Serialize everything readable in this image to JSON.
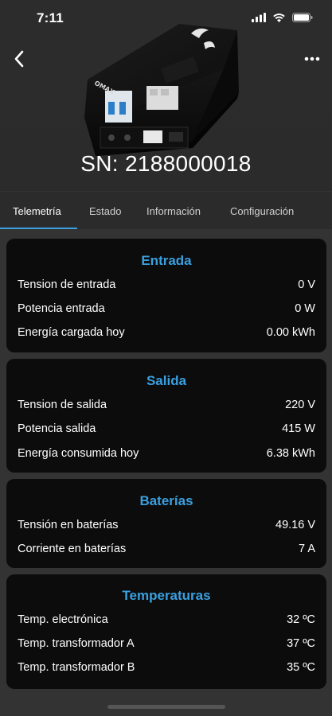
{
  "status_bar": {
    "time": "7:11"
  },
  "header": {
    "serial": "SN: 2188000018",
    "device_brand": "OMAX"
  },
  "tabs": [
    {
      "label": "Telemetría",
      "active": true
    },
    {
      "label": "Estado",
      "active": false
    },
    {
      "label": "Información",
      "active": false
    },
    {
      "label": "Configuración",
      "active": false
    }
  ],
  "sections": [
    {
      "title": "Entrada",
      "rows": [
        {
          "label": "Tension de entrada",
          "value": "0 V"
        },
        {
          "label": "Potencia entrada",
          "value": "0 W"
        },
        {
          "label": "Energía cargada hoy",
          "value": "0.00 kWh"
        }
      ]
    },
    {
      "title": "Salida",
      "rows": [
        {
          "label": "Tension de salida",
          "value": "220 V"
        },
        {
          "label": "Potencia salida",
          "value": "415 W"
        },
        {
          "label": "Energía consumida hoy",
          "value": "6.38 kWh"
        }
      ]
    },
    {
      "title": "Baterías",
      "rows": [
        {
          "label": "Tensión en baterías",
          "value": "49.16 V"
        },
        {
          "label": "Corriente en baterías",
          "value": "7 A"
        }
      ]
    },
    {
      "title": "Temperaturas",
      "rows": [
        {
          "label": "Temp. electrónica",
          "value": "32 ºC"
        },
        {
          "label": "Temp. transformador A",
          "value": "37 ºC"
        },
        {
          "label": "Temp. transformador B",
          "value": "35 ºC"
        }
      ]
    }
  ],
  "colors": {
    "accent": "#3aa0e0",
    "card_bg": "#0c0c0c",
    "page_bg": "#333333"
  }
}
